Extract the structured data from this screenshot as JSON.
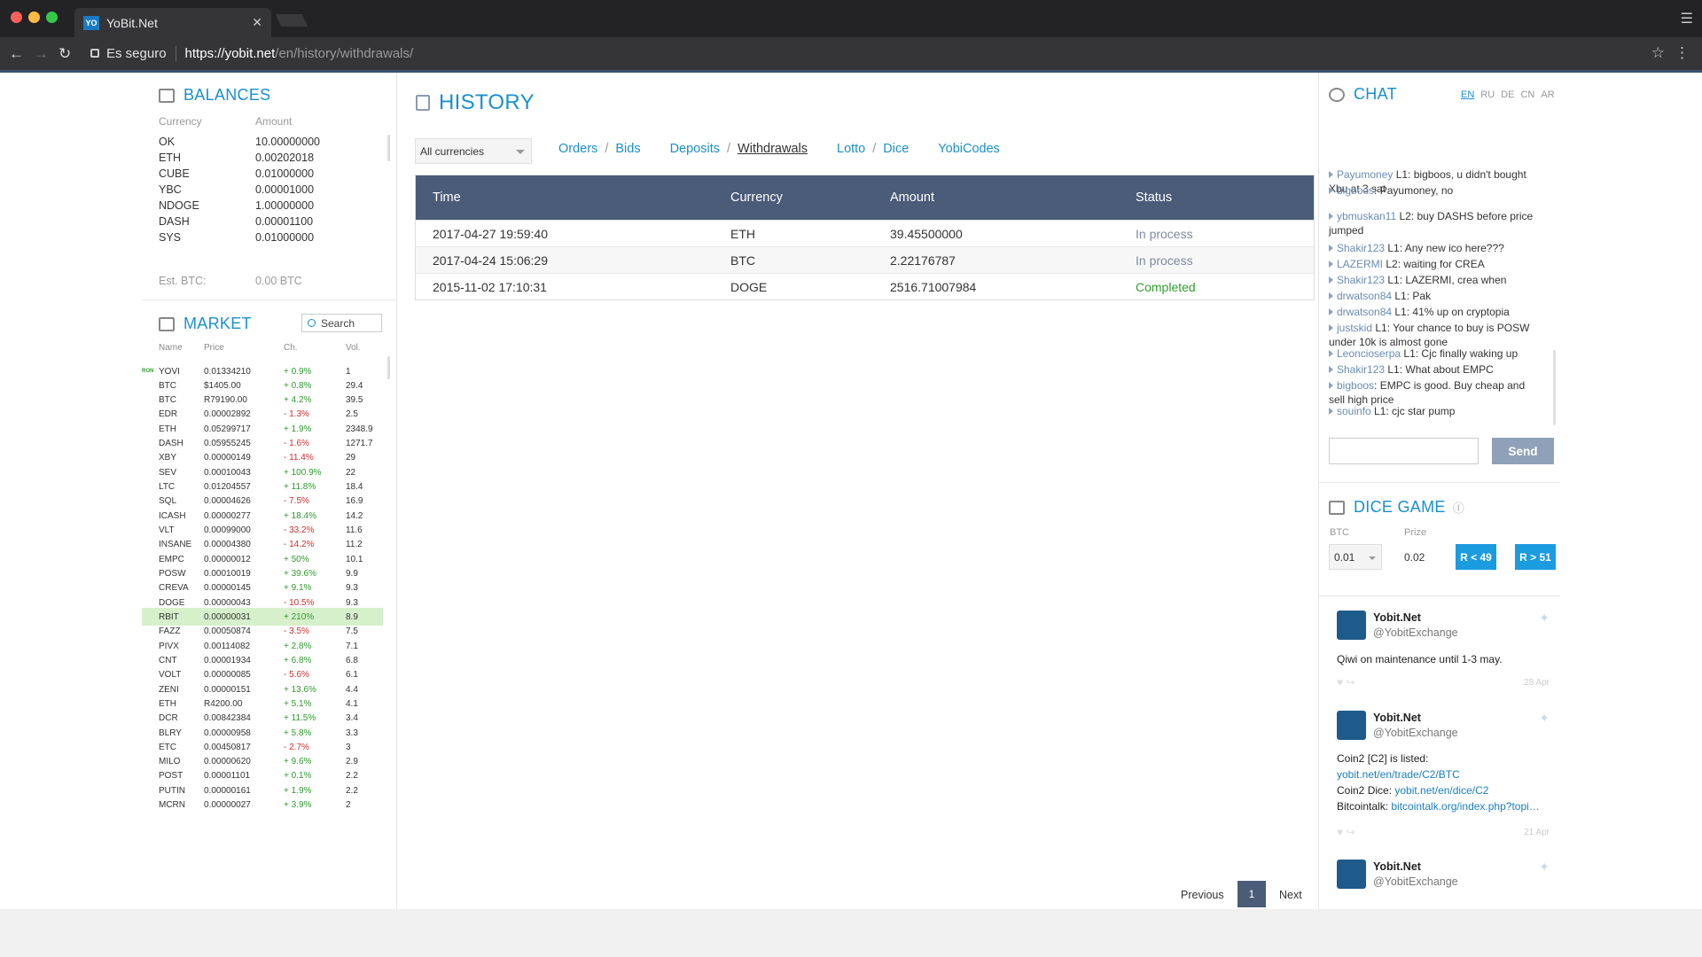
{
  "browser": {
    "tab_title": "YoBit.Net",
    "favicon_text": "YO",
    "secure_label": "Es seguro",
    "url_host": "https://yobit.net",
    "url_path": "/en/history/withdrawals/"
  },
  "balances": {
    "title": "BALANCES",
    "col_currency": "Currency",
    "col_amount": "Amount",
    "rows": [
      {
        "currency": "OK",
        "amount": "10.00000000"
      },
      {
        "currency": "ETH",
        "amount": "0.00202018"
      },
      {
        "currency": "CUBE",
        "amount": "0.01000000"
      },
      {
        "currency": "YBC",
        "amount": "0.00001000"
      },
      {
        "currency": "NDOGE",
        "amount": "1.00000000"
      },
      {
        "currency": "DASH",
        "amount": "0.00001100"
      },
      {
        "currency": "SYS",
        "amount": "0.01000000"
      }
    ],
    "est_label": "Est. BTC:",
    "est_value": "0.00 BTC"
  },
  "market": {
    "title": "MARKET",
    "search_placeholder": "Search",
    "col_name": "Name",
    "col_price": "Price",
    "col_change": "Ch.",
    "col_vol": "Vol.",
    "rows": [
      {
        "tag": "RON",
        "name": "YOVI",
        "price": "0.01334210",
        "change": "+ 0.9%",
        "dir": "pos",
        "vol": "1"
      },
      {
        "tag": "",
        "name": "BTC",
        "price": "$1405.00",
        "change": "+ 0.8%",
        "dir": "pos",
        "vol": "29.4"
      },
      {
        "tag": "",
        "name": "BTC",
        "price": "R79190.00",
        "change": "+ 4.2%",
        "dir": "pos",
        "vol": "39.5"
      },
      {
        "tag": "",
        "name": "EDR",
        "price": "0.00002892",
        "change": "- 1.3%",
        "dir": "neg",
        "vol": "2.5"
      },
      {
        "tag": "",
        "name": "ETH",
        "price": "0.05299717",
        "change": "+ 1.9%",
        "dir": "pos",
        "vol": "2348.9"
      },
      {
        "tag": "",
        "name": "DASH",
        "price": "0.05955245",
        "change": "- 1.6%",
        "dir": "neg",
        "vol": "1271.7"
      },
      {
        "tag": "",
        "name": "XBY",
        "price": "0.00000149",
        "change": "- 11.4%",
        "dir": "neg",
        "vol": "29"
      },
      {
        "tag": "",
        "name": "SEV",
        "price": "0.00010043",
        "change": "+ 100.9%",
        "dir": "pos",
        "vol": "22"
      },
      {
        "tag": "",
        "name": "LTC",
        "price": "0.01204557",
        "change": "+ 11.8%",
        "dir": "pos",
        "vol": "18.4"
      },
      {
        "tag": "",
        "name": "SQL",
        "price": "0.00004626",
        "change": "- 7.5%",
        "dir": "neg",
        "vol": "16.9"
      },
      {
        "tag": "",
        "name": "ICASH",
        "price": "0.00000277",
        "change": "+ 18.4%",
        "dir": "pos",
        "vol": "14.2"
      },
      {
        "tag": "",
        "name": "VLT",
        "price": "0.00099000",
        "change": "- 33.2%",
        "dir": "neg",
        "vol": "11.6"
      },
      {
        "tag": "",
        "name": "INSANE",
        "price": "0.00004380",
        "change": "- 14.2%",
        "dir": "neg",
        "vol": "11.2"
      },
      {
        "tag": "",
        "name": "EMPC",
        "price": "0.00000012",
        "change": "+ 50%",
        "dir": "pos",
        "vol": "10.1"
      },
      {
        "tag": "",
        "name": "POSW",
        "price": "0.00010019",
        "change": "+ 39.6%",
        "dir": "pos",
        "vol": "9.9"
      },
      {
        "tag": "",
        "name": "CREVA",
        "price": "0.00000145",
        "change": "+ 9.1%",
        "dir": "pos",
        "vol": "9.3"
      },
      {
        "tag": "",
        "name": "DOGE",
        "price": "0.00000043",
        "change": "- 10.5%",
        "dir": "neg",
        "vol": "9.3"
      },
      {
        "tag": "",
        "name": "RBIT",
        "price": "0.00000031",
        "change": "+ 210%",
        "dir": "pos",
        "vol": "8.9",
        "highlight": true
      },
      {
        "tag": "",
        "name": "FAZZ",
        "price": "0.00050874",
        "change": "- 3.5%",
        "dir": "neg",
        "vol": "7.5"
      },
      {
        "tag": "",
        "name": "PIVX",
        "price": "0.00114082",
        "change": "+ 2.8%",
        "dir": "pos",
        "vol": "7.1"
      },
      {
        "tag": "",
        "name": "CNT",
        "price": "0.00001934",
        "change": "+ 6.8%",
        "dir": "pos",
        "vol": "6.8"
      },
      {
        "tag": "",
        "name": "VOLT",
        "price": "0.00000085",
        "change": "- 5.6%",
        "dir": "neg",
        "vol": "6.1"
      },
      {
        "tag": "",
        "name": "ZENI",
        "price": "0.00000151",
        "change": "+ 13.6%",
        "dir": "pos",
        "vol": "4.4"
      },
      {
        "tag": "",
        "name": "ETH",
        "price": "R4200.00",
        "change": "+ 5.1%",
        "dir": "pos",
        "vol": "4.1"
      },
      {
        "tag": "",
        "name": "DCR",
        "price": "0.00842384",
        "change": "+ 11.5%",
        "dir": "pos",
        "vol": "3.4"
      },
      {
        "tag": "",
        "name": "BLRY",
        "price": "0.00000958",
        "change": "+ 5.8%",
        "dir": "pos",
        "vol": "3.3"
      },
      {
        "tag": "",
        "name": "ETC",
        "price": "0.00450817",
        "change": "- 2.7%",
        "dir": "neg",
        "vol": "3"
      },
      {
        "tag": "",
        "name": "MILO",
        "price": "0.00000620",
        "change": "+ 9.6%",
        "dir": "pos",
        "vol": "2.9"
      },
      {
        "tag": "",
        "name": "POST",
        "price": "0.00001101",
        "change": "+ 0.1%",
        "dir": "pos",
        "vol": "2.2"
      },
      {
        "tag": "",
        "name": "PUTIN",
        "price": "0.00000161",
        "change": "+ 1.9%",
        "dir": "pos",
        "vol": "2.2"
      },
      {
        "tag": "",
        "name": "MCRN",
        "price": "0.00000027",
        "change": "+ 3.9%",
        "dir": "pos",
        "vol": "2"
      }
    ]
  },
  "history": {
    "title": "HISTORY",
    "currency_filter": "All currencies",
    "nav": {
      "orders": "Orders",
      "bids": "Bids",
      "deposits": "Deposits",
      "withdrawals": "Withdrawals",
      "lotto": "Lotto",
      "dice": "Dice",
      "yobicodes": "YobiCodes",
      "sep": "/"
    },
    "columns": {
      "time": "Time",
      "currency": "Currency",
      "amount": "Amount",
      "status": "Status"
    },
    "rows": [
      {
        "time": "2017-04-27 19:59:40",
        "currency": "ETH",
        "amount": "39.45500000",
        "status": "In process",
        "state": "proc"
      },
      {
        "time": "2017-04-24 15:06:29",
        "currency": "BTC",
        "amount": "2.22176787",
        "status": "In process",
        "state": "proc"
      },
      {
        "time": "2015-11-02 17:10:31",
        "currency": "DOGE",
        "amount": "2516.71007984",
        "status": "Completed",
        "state": "done"
      }
    ],
    "pager": {
      "previous": "Previous",
      "page": "1",
      "next": "Next"
    }
  },
  "chat": {
    "title": "CHAT",
    "langs": [
      "EN",
      "RU",
      "DE",
      "CN",
      "AR"
    ],
    "messages": [
      {
        "user": "Payumoney",
        "text": " L1: bigboos, u didn't bought Xbu at 3 sat"
      },
      {
        "user": "bigboos",
        "text": ": Payumoney, no"
      },
      {
        "user": "ybmuskan11",
        "text": " L2: buy DASHS before price jumped"
      },
      {
        "user": "Shakir123",
        "text": " L1: Any new ico here???"
      },
      {
        "user": "LAZERMI",
        "text": " L2: waiting for CREA"
      },
      {
        "user": "Shakir123",
        "text": " L1: LAZERMI, crea when"
      },
      {
        "user": "drwatson84",
        "text": " L1: Pak"
      },
      {
        "user": "drwatson84",
        "text": " L1: 41% up on cryptopia"
      },
      {
        "user": "justskid",
        "text": " L1: Your chance to buy is POSW under 10k is almost gone"
      },
      {
        "user": "Leoncioserpa",
        "text": " L1: Cjc finally waking up"
      },
      {
        "user": "Shakir123",
        "text": " L1: What about EMPC"
      },
      {
        "user": "bigboos",
        "text": ": EMPC is good. Buy cheap and sell high price"
      },
      {
        "user": "souinfo",
        "text": " L1: cjc star pump"
      }
    ],
    "send_label": "Send"
  },
  "dice": {
    "title": "DICE GAME",
    "btc_label": "BTC",
    "prize_label": "Prize",
    "bet_value": "0.01",
    "prize_value": "0.02",
    "btn_low": "R < 49",
    "btn_high": "R > 51"
  },
  "tweets": [
    {
      "name": "Yobit.Net",
      "handle": "@YobitExchange",
      "lines": [
        "Qiwi on maintenance until 1-3 may."
      ],
      "date": "28 Apr"
    },
    {
      "name": "Yobit.Net",
      "handle": "@YobitExchange",
      "lines": [
        "Coin2 [C2] is listed:"
      ],
      "link1": "yobit.net/en/trade/C2/BTC",
      "line3_prefix": "Coin2 Dice: ",
      "link2": "yobit.net/en/dice/C2",
      "line4_prefix": "Bitcointalk: ",
      "link3": "bitcointalk.org/index.php?topi…",
      "date": "21 Apr"
    },
    {
      "name": "Yobit.Net",
      "handle": "@YobitExchange"
    }
  ]
}
